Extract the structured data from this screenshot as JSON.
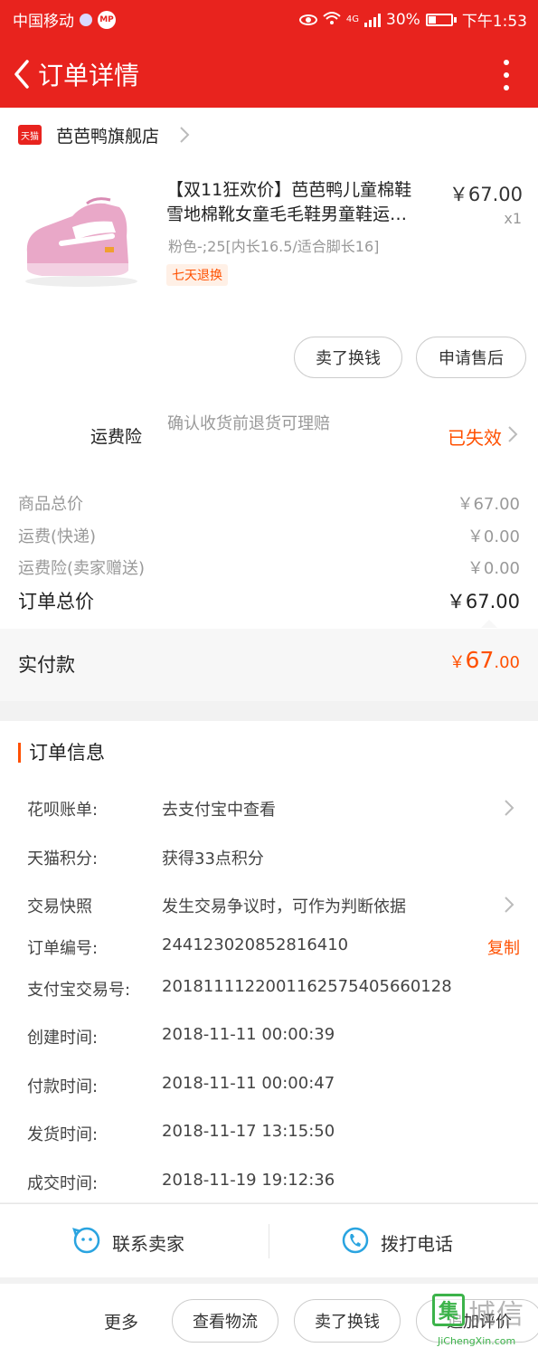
{
  "status_bar": {
    "carrier": "中国移动",
    "mp_badge": "MP",
    "network": "4G",
    "battery": "30%",
    "time": "下午1:53"
  },
  "nav": {
    "title": "订单详情",
    "back_icon": "chevron-left-icon",
    "more_icon": "more-vertical-icon"
  },
  "store": {
    "badge": "天猫",
    "name": "芭芭鸭旗舰店"
  },
  "product": {
    "title_line1": "【双11狂欢价】芭芭鸭儿童棉鞋",
    "title_line2": "雪地棉靴女童毛毛鞋男童鞋运…",
    "price": "￥67.00",
    "quantity": "x1",
    "spec": "粉色-;25[内长16.5/适合脚长16]",
    "tag": "七天退换"
  },
  "product_actions": {
    "sell": "卖了换钱",
    "after_sale": "申请售后"
  },
  "insurance": {
    "label": "运费险",
    "desc": "确认收货前退货可理赔",
    "status": "已失效"
  },
  "fees": [
    {
      "label": "商品总价",
      "value": "￥67.00"
    },
    {
      "label": "运费(快递)",
      "value": "￥0.00"
    },
    {
      "label": "运费险(卖家赠送)",
      "value": "￥0.00"
    }
  ],
  "order_total": {
    "label": "订单总价",
    "value": "￥67.00"
  },
  "paid": {
    "label": "实付款",
    "currency": "￥",
    "int": "67",
    "dec": ".00"
  },
  "order_info": {
    "heading": "订单信息",
    "rows": [
      {
        "key": "花呗账单:",
        "value": "去支付宝中查看"
      },
      {
        "key": "天猫积分:",
        "value": "获得33点积分"
      },
      {
        "key": "交易快照",
        "value": "发生交易争议时，可作为判断依据"
      },
      {
        "key": "订单编号:",
        "value": "244123020852816410",
        "action": "复制"
      },
      {
        "key": "支付宝交易号:",
        "value": "2018111122001162575405660128"
      },
      {
        "key": "创建时间:",
        "value": "2018-11-11 00:00:39"
      },
      {
        "key": "付款时间:",
        "value": "2018-11-11 00:00:47"
      },
      {
        "key": "发货时间:",
        "value": "2018-11-17 13:15:50"
      },
      {
        "key": "成交时间:",
        "value": "2018-11-19 19:12:36"
      }
    ]
  },
  "contact": {
    "seller": "联系卖家",
    "phone": "拨打电话"
  },
  "bottom_actions": {
    "more": "更多",
    "logistics": "查看物流",
    "sell": "卖了换钱",
    "review": "追加评价"
  },
  "watermark": {
    "icon_char": "集",
    "text": "城信",
    "url": "JiChengXin.com"
  },
  "colors": {
    "brand_red": "#e8231e",
    "accent_orange": "#ff5000",
    "watermark_green": "#3cb34a"
  }
}
